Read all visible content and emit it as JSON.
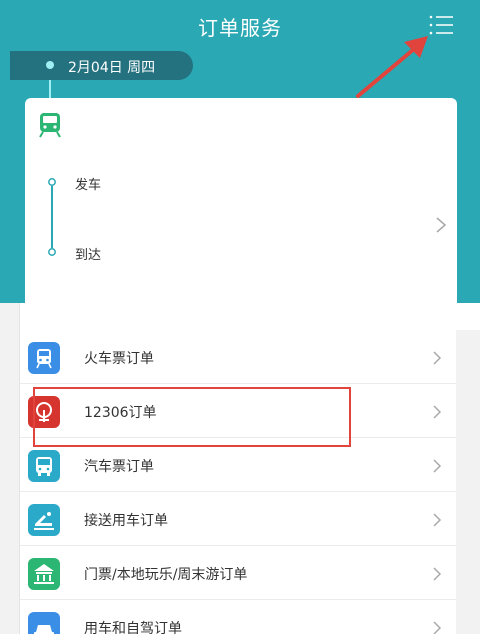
{
  "header": {
    "title": "订单服务",
    "menu_icon": "list-menu-icon",
    "background": "#2aa9b5"
  },
  "date_bar": {
    "text": "2月04日 周四"
  },
  "trip_card": {
    "icon": "train-icon",
    "depart_label": "发车",
    "arrive_label": "到达"
  },
  "orders": {
    "items": [
      {
        "label": "火车票订单",
        "icon": "train-icon",
        "color": "#3a8ee6"
      },
      {
        "label": "12306订单",
        "icon": "railway-logo-icon",
        "color": "#d6352f"
      },
      {
        "label": "汽车票订单",
        "icon": "bus-icon",
        "color": "#2aa9c9"
      },
      {
        "label": "接送用车订单",
        "icon": "airport-transfer-icon",
        "color": "#2aa9c9"
      },
      {
        "label": "门票/本地玩乐/周末游订单",
        "icon": "attraction-icon",
        "color": "#2bb673"
      },
      {
        "label": "用车和自驾订单",
        "icon": "car-icon",
        "color": "#3a8ee6"
      }
    ]
  },
  "annotation": {
    "highlight_color": "#e0443c"
  }
}
